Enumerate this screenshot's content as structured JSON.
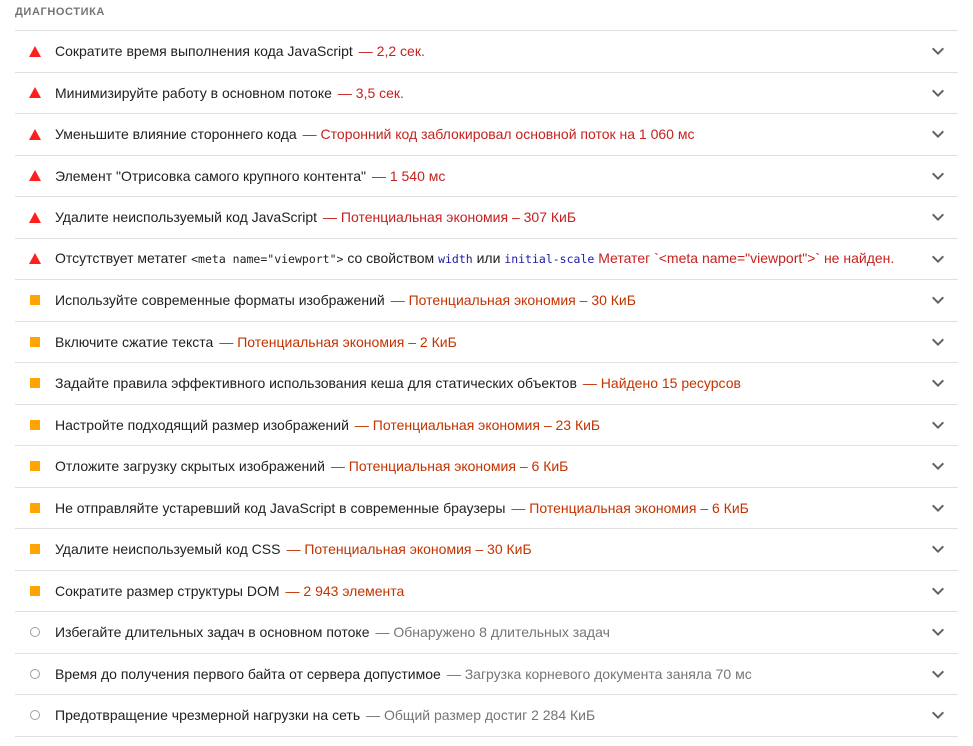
{
  "section": {
    "title": "ДИАГНОСТИКА"
  },
  "colors": {
    "fail": "#ff1f1f",
    "average": "#ffa400",
    "pass_outline": "#9e9e9e",
    "display_red": "#c5221f",
    "display_orange": "#c33300",
    "display_gray": "#757575"
  },
  "audits": [
    {
      "severity": "fail",
      "icon": "fail-triangle-icon",
      "title": "Сократите время выполнения кода JavaScript",
      "display": "— 2,2 сек."
    },
    {
      "severity": "fail",
      "icon": "fail-triangle-icon",
      "title": "Минимизируйте работу в основном потоке",
      "display": "— 3,5 сек."
    },
    {
      "severity": "fail",
      "icon": "fail-triangle-icon",
      "title": "Уменьшите влияние стороннего кода",
      "display": "— Сторонний код заблокировал основной поток на 1 060 мс"
    },
    {
      "severity": "fail",
      "icon": "fail-triangle-icon",
      "title": "Элемент \"Отрисовка самого крупного контента\"",
      "display": "— 1 540 мс"
    },
    {
      "severity": "fail",
      "icon": "fail-triangle-icon",
      "title": "Удалите неиспользуемый код JavaScript",
      "display": "— Потенциальная экономия – 307 КиБ"
    },
    {
      "severity": "fail",
      "icon": "fail-triangle-icon",
      "title_part1": "Отсутствует метатег",
      "code_tag": "<meta name=\"viewport\">",
      "title_part2": "со свойством",
      "code_width": "width",
      "title_part3": "или",
      "code_scale": "initial-scale",
      "display": "Метатег `<meta name=\"viewport\">` не найден."
    },
    {
      "severity": "average",
      "icon": "average-square-icon",
      "title": "Используйте современные форматы изображений",
      "display": "— Потенциальная экономия – 30 КиБ"
    },
    {
      "severity": "average",
      "icon": "average-square-icon",
      "title": "Включите сжатие текста",
      "display": "— Потенциальная экономия – 2 КиБ"
    },
    {
      "severity": "average",
      "icon": "average-square-icon",
      "title": "Задайте правила эффективного использования кеша для статических объектов",
      "display": "— Найдено 15 ресурсов"
    },
    {
      "severity": "average",
      "icon": "average-square-icon",
      "title": "Настройте подходящий размер изображений",
      "display": "— Потенциальная экономия – 23 КиБ"
    },
    {
      "severity": "average",
      "icon": "average-square-icon",
      "title": "Отложите загрузку скрытых изображений",
      "display": "— Потенциальная экономия – 6 КиБ"
    },
    {
      "severity": "average",
      "icon": "average-square-icon",
      "title": "Не отправляйте устаревший код JavaScript в современные браузеры",
      "display": "— Потенциальная экономия – 6 КиБ"
    },
    {
      "severity": "average",
      "icon": "average-square-icon",
      "title": "Удалите неиспользуемый код CSS",
      "display": "— Потенциальная экономия – 30 КиБ"
    },
    {
      "severity": "average",
      "icon": "average-square-icon",
      "title": "Сократите размер структуры DOM",
      "display": "— 2 943 элемента"
    },
    {
      "severity": "info",
      "icon": "info-circle-icon",
      "title": "Избегайте длительных задач в основном потоке",
      "display": "— Обнаружено 8 длительных задач"
    },
    {
      "severity": "info",
      "icon": "info-circle-icon",
      "title": "Время до получения первого байта от сервера допустимое",
      "display": "— Загрузка корневого документа заняла 70 мс"
    },
    {
      "severity": "info",
      "icon": "info-circle-icon",
      "title": "Предотвращение чрезмерной нагрузки на сеть",
      "display": "— Общий размер достиг 2 284 КиБ"
    }
  ]
}
